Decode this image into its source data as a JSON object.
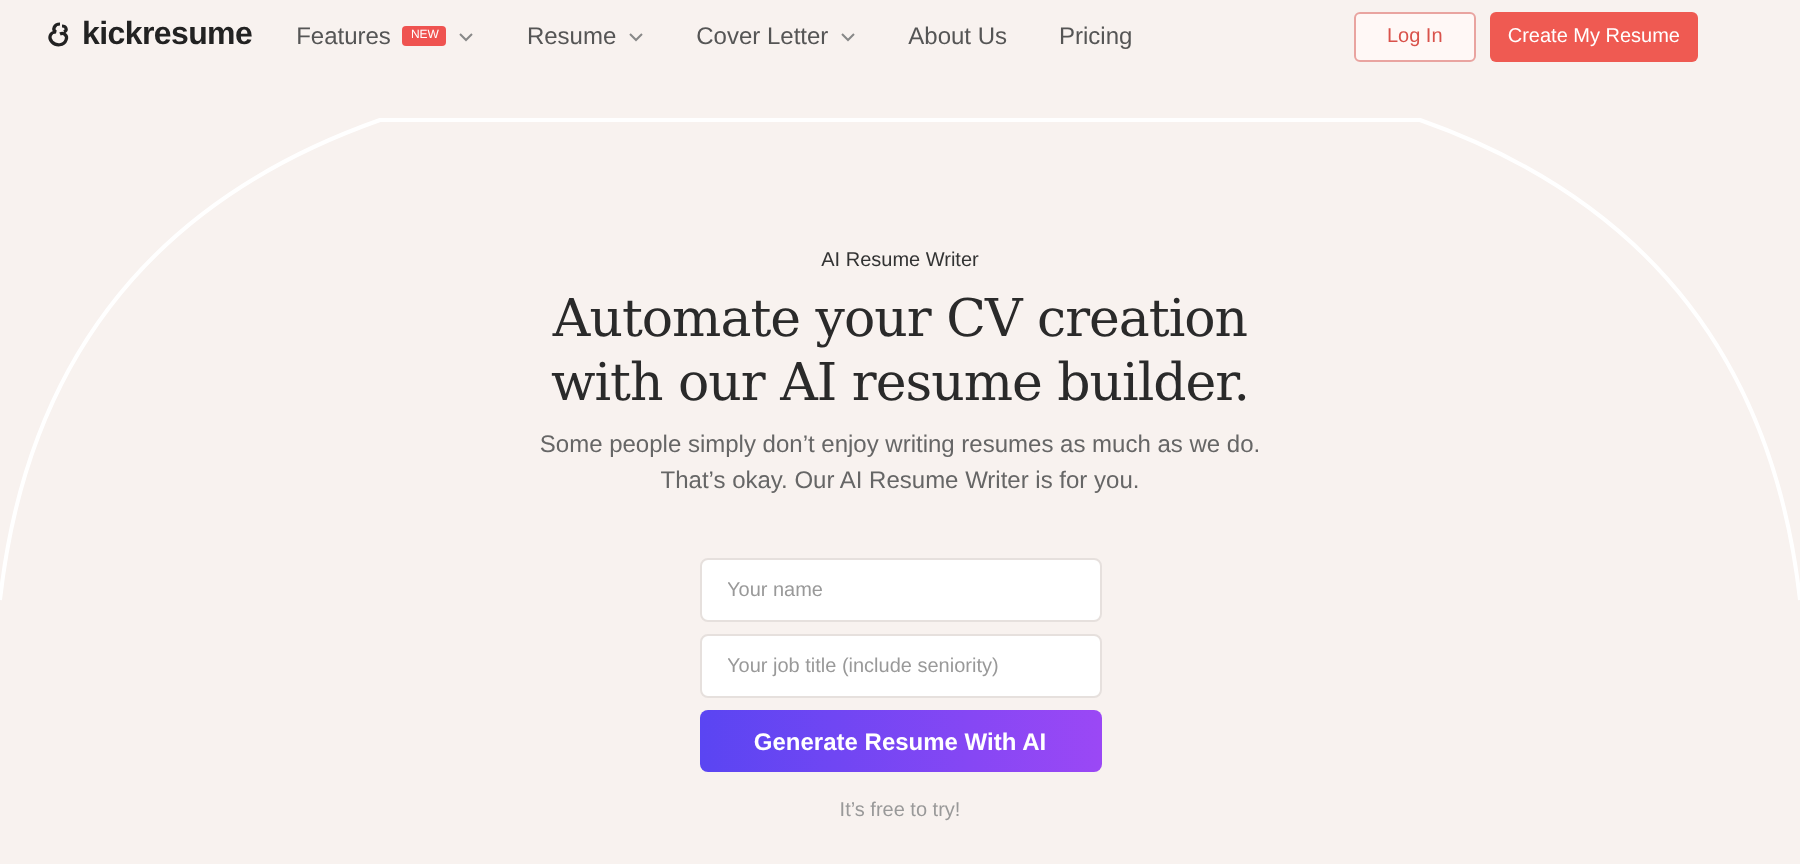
{
  "logo": {
    "text": "kickresume"
  },
  "nav": [
    {
      "label": "Features",
      "badge": "NEW",
      "has_menu": true
    },
    {
      "label": "Resume",
      "has_menu": true
    },
    {
      "label": "Cover Letter",
      "has_menu": true
    },
    {
      "label": "About Us",
      "has_menu": false
    },
    {
      "label": "Pricing",
      "has_menu": false
    }
  ],
  "actions": {
    "login": "Log In",
    "signup": "Create My Resume"
  },
  "hero": {
    "eyebrow": "AI Resume Writer",
    "title_lines": [
      "Automate your CV creation",
      "with our AI resume builder."
    ],
    "subtitle_lines": [
      "Some people simply don’t enjoy writing resumes as much as we do.",
      "That’s okay. Our AI Resume Writer is for you."
    ]
  },
  "form": {
    "fields": [
      {
        "placeholder": "Your name"
      },
      {
        "placeholder": "Your job title (include seniority)"
      }
    ],
    "submit": "Generate Resume With AI",
    "note": "It’s free to try!"
  }
}
